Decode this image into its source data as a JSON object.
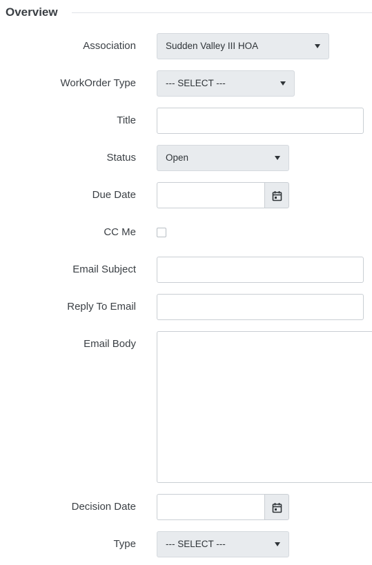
{
  "section": {
    "title": "Overview"
  },
  "form": {
    "association": {
      "label": "Association",
      "selected": "Sudden Valley III HOA"
    },
    "workorder_type": {
      "label": "WorkOrder Type",
      "selected": "--- SELECT ---"
    },
    "title": {
      "label": "Title",
      "value": ""
    },
    "status": {
      "label": "Status",
      "selected": "Open"
    },
    "due_date": {
      "label": "Due Date",
      "value": "",
      "icon": "calendar-icon"
    },
    "cc_me": {
      "label": "CC Me",
      "checked": false
    },
    "email_subject": {
      "label": "Email Subject",
      "value": ""
    },
    "reply_to_email": {
      "label": "Reply To Email",
      "value": ""
    },
    "email_body": {
      "label": "Email Body",
      "value": ""
    },
    "decision_date": {
      "label": "Decision Date",
      "value": "",
      "icon": "calendar-icon"
    },
    "type": {
      "label": "Type",
      "selected": "--- SELECT ---"
    }
  },
  "icons": {
    "dropdown": "caret-down-icon",
    "calendar": "calendar-icon"
  },
  "colors": {
    "select_background": "#e8ebee",
    "input_border": "#c9ced3",
    "label_text": "#3a3f44"
  }
}
